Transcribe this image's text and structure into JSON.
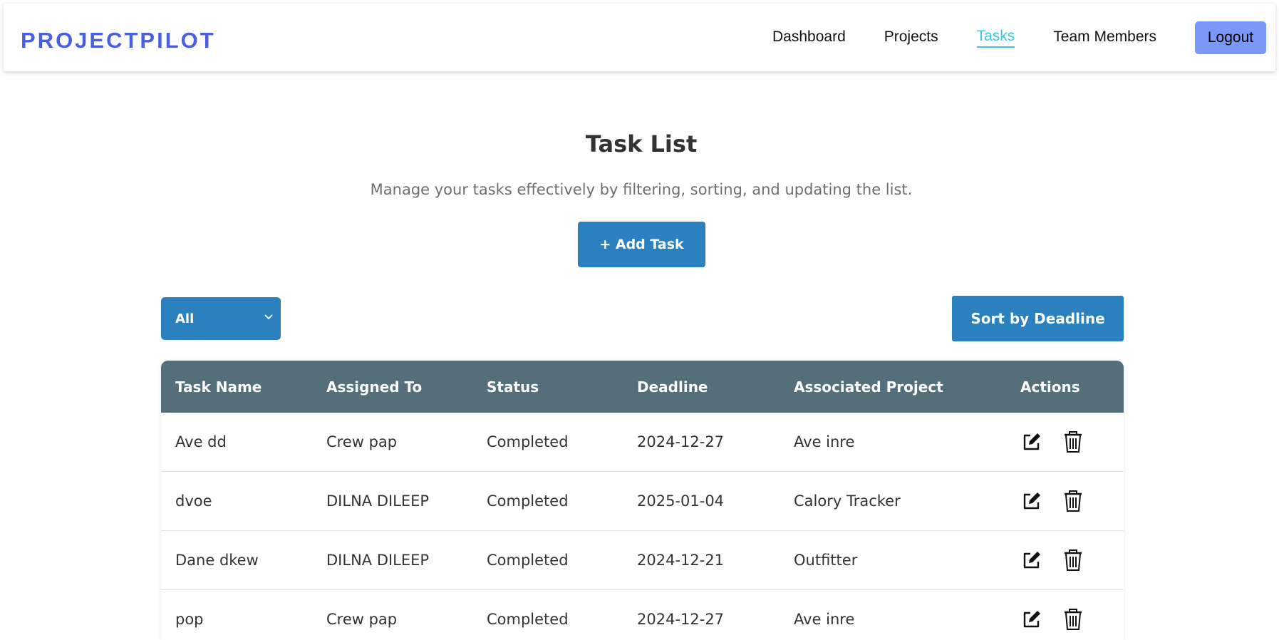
{
  "nav": {
    "logo": "PROJECTPILOT",
    "links": [
      {
        "label": "Dashboard"
      },
      {
        "label": "Projects"
      },
      {
        "label": "Tasks"
      },
      {
        "label": "Team Members"
      }
    ],
    "active": "Tasks",
    "logout_label": "Logout"
  },
  "page": {
    "title": "Task List",
    "subtitle": "Manage your tasks effectively by filtering, sorting, and updating the list.",
    "add_button_label": "+ Add Task"
  },
  "filter": {
    "selected": "All"
  },
  "sort_button_label": "Sort by Deadline",
  "table": {
    "headers": [
      "Task Name",
      "Assigned To",
      "Status",
      "Deadline",
      "Associated Project",
      "Actions"
    ],
    "rows": [
      {
        "task": "Ave dd",
        "assigned": "Crew pap",
        "status": "Completed",
        "deadline": "2024-12-27",
        "project": "Ave inre"
      },
      {
        "task": "dvoe",
        "assigned": "DILNA DILEEP",
        "status": "Completed",
        "deadline": "2025-01-04",
        "project": "Calory Tracker"
      },
      {
        "task": "Dane dkew",
        "assigned": "DILNA DILEEP",
        "status": "Completed",
        "deadline": "2024-12-21",
        "project": "Outfitter"
      },
      {
        "task": "pop",
        "assigned": "Crew pap",
        "status": "Completed",
        "deadline": "2024-12-27",
        "project": "Ave inre"
      }
    ],
    "action_icons": [
      "edit-icon",
      "trash-icon"
    ]
  },
  "colors": {
    "logo": "#4a5fe0",
    "active_link": "#3cc5e6",
    "logout_bg": "#7b97f7",
    "primary_button": "#2b81bd",
    "table_header": "#546e7a"
  }
}
